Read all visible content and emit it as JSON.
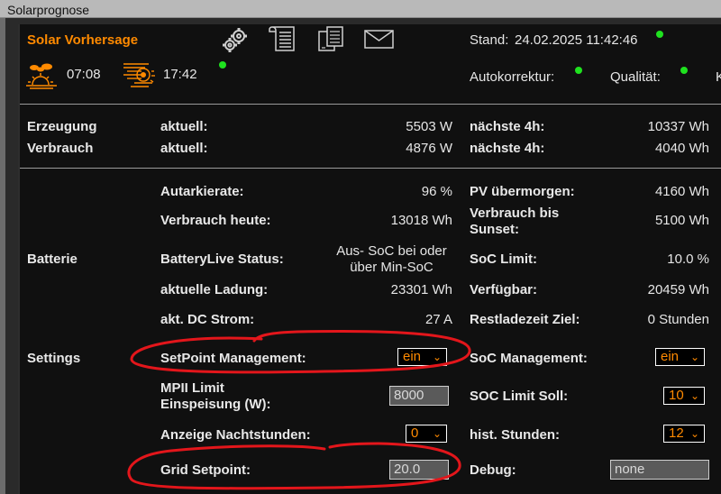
{
  "window": {
    "title": "Solarprognose"
  },
  "header": {
    "title": "Solar Vorhersage",
    "sunrise": "07:08",
    "sunset": "17:42",
    "stand_label": "Stand:",
    "stand_value": "24.02.2025 11:42:46",
    "autokorrektur_label": "Autokorrektur:",
    "qualitaet_label": "Qualität:",
    "cut_label": "K"
  },
  "icons": [
    "gear-icon",
    "list-icon",
    "documents-icon",
    "mail-icon",
    "sunrise-icon",
    "sunset-icon"
  ],
  "status_color": "#1fe21f",
  "accent_color": "#ff8a00",
  "rows": {
    "erzeugung": {
      "label": "Erzeugung",
      "sublabel": "aktuell:",
      "value": "5503 W",
      "label2": "nächste 4h:",
      "value2": "10337 Wh"
    },
    "verbrauch": {
      "label": "Verbrauch",
      "sublabel": "aktuell:",
      "value": "4876 W",
      "label2": "nächste 4h:",
      "value2": "4040 Wh"
    }
  },
  "batterie": {
    "section": "Batterie",
    "autarkie": {
      "label": "Autarkierate:",
      "value": "96 %",
      "label2": "PV übermorgen:",
      "value2": "4160 Wh"
    },
    "verbrauch_heute": {
      "label": "Verbrauch heute:",
      "value": "13018 Wh",
      "label2": "Verbrauch bis Sunset:",
      "value2": "5100 Wh"
    },
    "batterylive": {
      "label": "BatteryLive Status:",
      "value": "Aus- SoC bei oder über Min-SoC",
      "label2": "SoC Limit:",
      "value2": "10.0 %"
    },
    "ladung": {
      "label": "aktuelle Ladung:",
      "value": "23301 Wh",
      "label2": "Verfügbar:",
      "value2": "20459 Wh"
    },
    "dc_strom": {
      "label": "akt. DC Strom:",
      "value": "27 A",
      "label2": "Restladezeit Ziel:",
      "value2": "0 Stunden"
    }
  },
  "settings": {
    "section": "Settings",
    "setpoint_mgmt": {
      "label": "SetPoint Management:",
      "value": "ein"
    },
    "soc_mgmt": {
      "label": "SoC Management:",
      "value": "ein"
    },
    "mpii_limit": {
      "label": "MPII Limit Einspeisung (W):",
      "value": "8000"
    },
    "soc_limit_soll": {
      "label": "SOC Limit Soll:",
      "value": "10"
    },
    "nachtstunden": {
      "label": "Anzeige Nachtstunden:",
      "value": "0"
    },
    "hist_stunden": {
      "label": "hist. Stunden:",
      "value": "12"
    },
    "grid_setpoint": {
      "label": "Grid Setpoint:",
      "value": "20.0"
    },
    "debug": {
      "label": "Debug:",
      "value": "none"
    }
  }
}
